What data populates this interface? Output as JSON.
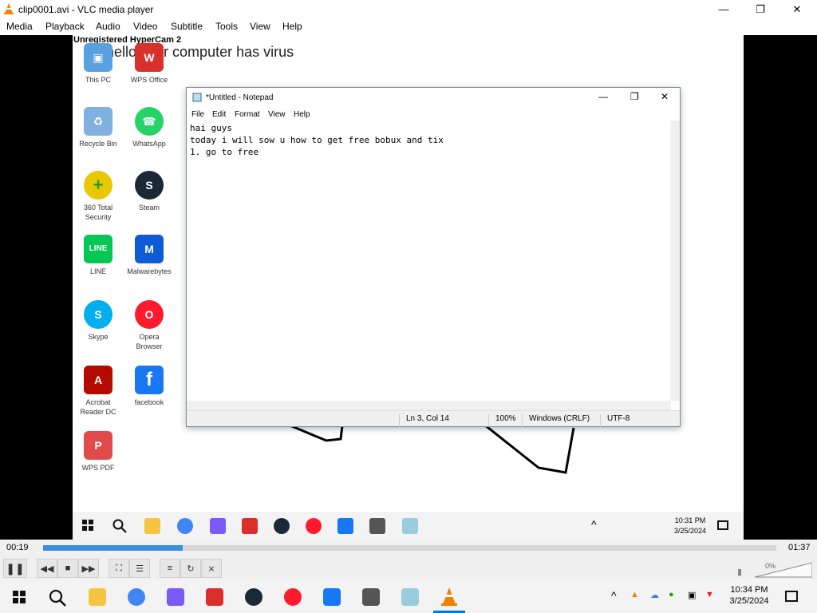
{
  "window": {
    "title": "clip0001.avi - VLC media player",
    "minimize": "—",
    "maximize": "❐",
    "close": "✕"
  },
  "menu": [
    "Media",
    "Playback",
    "Audio",
    "Video",
    "Subtitle",
    "Tools",
    "View",
    "Help"
  ],
  "video": {
    "watermark": "Unregistered HyperCam 2",
    "heading": "hello your computer has virus",
    "desktop_icons": [
      {
        "label": "This PC",
        "color": "#5aa0e0",
        "glyph": "▣"
      },
      {
        "label": "WPS Office",
        "color": "#d9302b",
        "glyph": "W"
      },
      {
        "label": "Recycle Bin",
        "color": "#7fb0e0",
        "glyph": "♻"
      },
      {
        "label": "WhatsApp",
        "color": "#25d366",
        "glyph": "☎"
      },
      {
        "label": "360 Total Security",
        "color": "#e8c800",
        "glyph": "+"
      },
      {
        "label": "Steam",
        "color": "#1b2838",
        "glyph": "S"
      },
      {
        "label": "LINE",
        "color": "#06c755",
        "glyph": "LINE"
      },
      {
        "label": "Malwarebytes",
        "color": "#0d5bd7",
        "glyph": "M"
      },
      {
        "label": "Skype",
        "color": "#00aff0",
        "glyph": "S"
      },
      {
        "label": "Opera Browser",
        "color": "#ff1b2d",
        "glyph": "O"
      },
      {
        "label": "Acrobat Reader DC",
        "color": "#b30b00",
        "glyph": "A"
      },
      {
        "label": "facebook",
        "color": "#1877f2",
        "glyph": "f"
      },
      {
        "label": "WPS PDF",
        "color": "#e04b4b",
        "glyph": "P"
      }
    ],
    "notepad": {
      "title": "*Untitled - Notepad",
      "menu": [
        "File",
        "Edit",
        "Format",
        "View",
        "Help"
      ],
      "text": "hai guys\ntoday i will sow u how to get free bobux and tix\n1. go to free",
      "status": {
        "position": "Ln 3, Col 14",
        "zoom": "100%",
        "line_endings": "Windows (CRLF)",
        "encoding": "UTF-8"
      }
    },
    "inner_taskbar": {
      "time": "10:31 PM",
      "date": "3/25/2024"
    }
  },
  "player": {
    "elapsed": "00:19",
    "total": "01:37",
    "progress": 0.19,
    "volume_label": "0%",
    "buttons": [
      "pause",
      "previous",
      "stop",
      "next",
      "fullscreen",
      "extended-settings",
      "playlist",
      "loop",
      "shuffle"
    ]
  },
  "taskbar": {
    "time": "10:34 PM",
    "date": "3/25/2024"
  },
  "colors": {
    "seek_fill": "#3a8fdf",
    "accent": "#0078d7"
  }
}
